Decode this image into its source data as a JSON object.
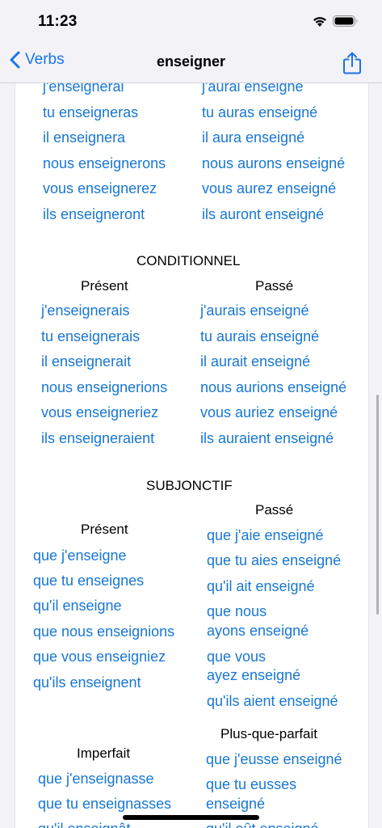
{
  "status": {
    "time": "11:23"
  },
  "nav": {
    "back_label": "Verbs",
    "title": "enseigner"
  },
  "futur_simple": [
    "j'enseignerai",
    "tu enseigneras",
    "il enseignera",
    "nous enseignerons",
    "vous enseignerez",
    "ils enseigneront"
  ],
  "futur_anterieur": [
    "j'aurai enseigné",
    "tu auras enseigné",
    "il aura enseigné",
    "nous aurons enseigné",
    "vous aurez enseigné",
    "ils auront enseigné"
  ],
  "conditionnel": {
    "heading": "CONDITIONNEL",
    "present_label": "Présent",
    "passe_label": "Passé",
    "present": [
      "j'enseignerais",
      "tu enseignerais",
      "il enseignerait",
      "nous enseignerions",
      "vous enseigneriez",
      "ils enseigneraient"
    ],
    "passe": [
      "j'aurais enseigné",
      "tu aurais enseigné",
      "il aurait enseigné",
      "nous aurions enseigné",
      "vous auriez enseigné",
      "ils auraient enseigné"
    ]
  },
  "subjonctif": {
    "heading": "SUBJONCTIF",
    "present_label": "Présent",
    "passe_label": "Passé",
    "present": [
      "que j'enseigne",
      "que tu enseignes",
      "qu'il enseigne",
      "que nous enseignions",
      "que vous enseigniez",
      "qu'ils enseignent"
    ],
    "passe": [
      "que j'aie enseigné",
      "que tu aies enseigné",
      "qu'il ait enseigné",
      "que nous",
      "ayons enseigné",
      "que vous",
      "ayez enseigné",
      "qu'ils aient enseigné"
    ],
    "imparfait_label": "Imperfait",
    "plus_que_parfait_label": "Plus-que-parfait",
    "imparfait": [
      "que j'enseignasse",
      "que tu enseignasses",
      "qu'il enseignât"
    ],
    "plus_que_parfait": [
      "que j'eusse enseigné",
      "que tu eusses",
      "enseigné",
      "qu'il eût enseigné"
    ]
  }
}
